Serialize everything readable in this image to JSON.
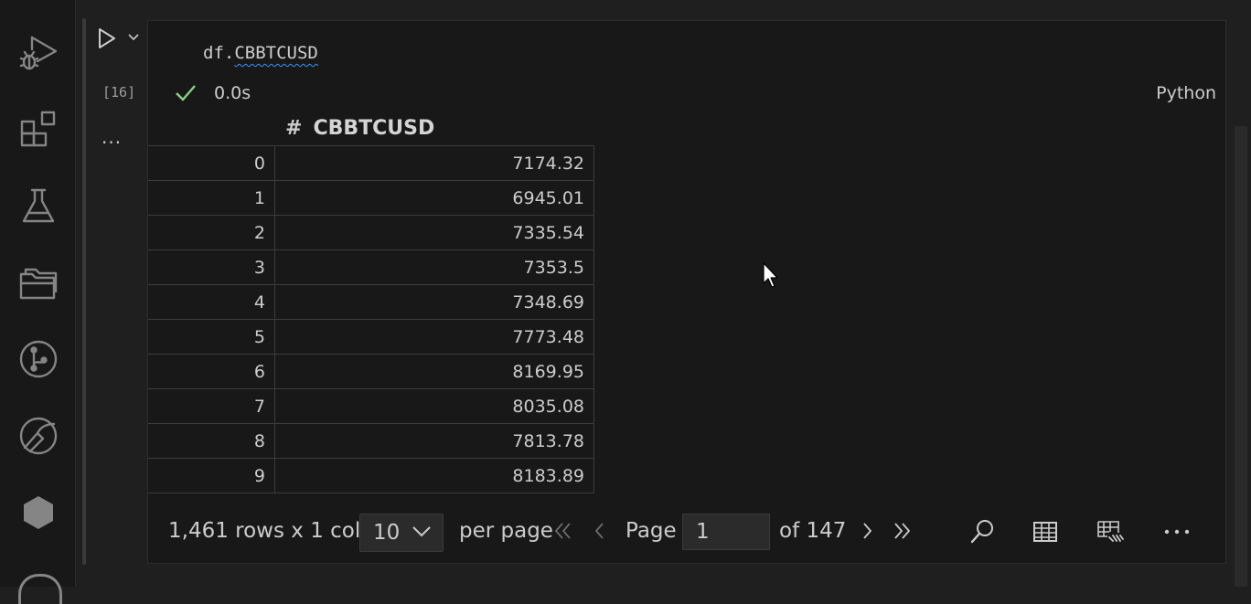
{
  "activity_bar": {
    "items": [
      {
        "icon": "run-debug-icon"
      },
      {
        "icon": "extensions-icon"
      },
      {
        "icon": "testing-flask-icon"
      },
      {
        "icon": "explorer-folders-icon"
      },
      {
        "icon": "source-control-icon"
      },
      {
        "icon": "remote-explorer-icon"
      },
      {
        "icon": "hexagon-extension-icon"
      }
    ]
  },
  "cell": {
    "code_prefix": "df.",
    "code_attr": "CBBTCUSD",
    "execution_count": "[16]",
    "duration": "0.0s",
    "language": "Python",
    "more_label": "..."
  },
  "output": {
    "columns": [
      {
        "type_icon": "#",
        "name": "CBBTCUSD"
      }
    ],
    "rows": [
      {
        "index": "0",
        "value": "7174.32"
      },
      {
        "index": "1",
        "value": "6945.01"
      },
      {
        "index": "2",
        "value": "7335.54"
      },
      {
        "index": "3",
        "value": "7353.5"
      },
      {
        "index": "4",
        "value": "7348.69"
      },
      {
        "index": "5",
        "value": "7773.48"
      },
      {
        "index": "6",
        "value": "8169.95"
      },
      {
        "index": "7",
        "value": "8035.08"
      },
      {
        "index": "8",
        "value": "7813.78"
      },
      {
        "index": "9",
        "value": "8183.89"
      }
    ],
    "pager": {
      "shape": "1,461 rows x 1 cols",
      "page_size": "10",
      "per_page_label": "per page",
      "page_label": "Page",
      "page_value": "1",
      "of_label": "of 147"
    }
  },
  "colors": {
    "background": "#1f1f1f",
    "cell_background": "#181818",
    "success_check": "#89d185",
    "squiggle": "#3794ff"
  }
}
